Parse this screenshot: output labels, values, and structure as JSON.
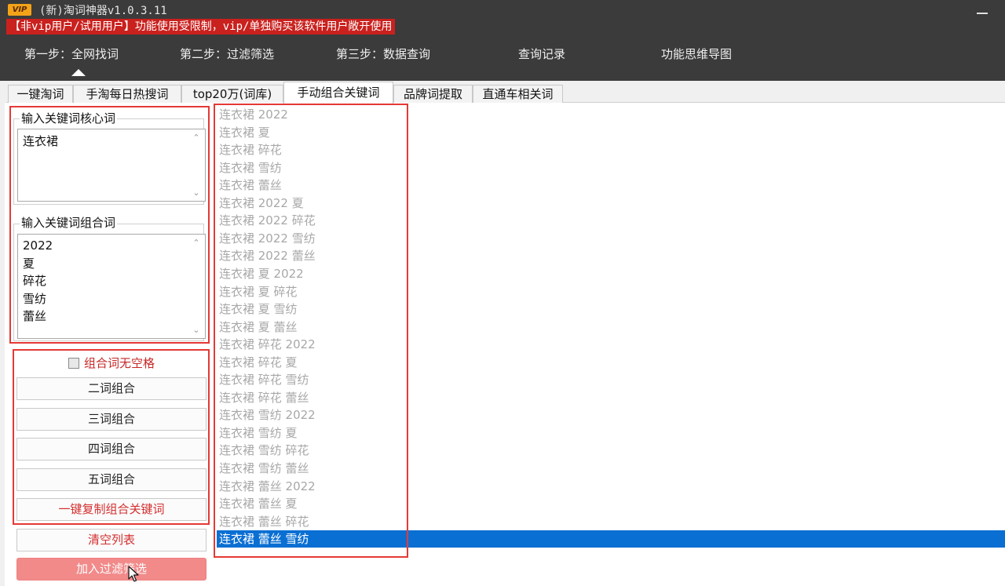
{
  "app": {
    "badge": "VIP",
    "title": "(新)淘词神器v1.0.3.11",
    "notice": "【非vip用户/试用用户】功能使用受限制，vip/单独购买该软件用户敞开使用"
  },
  "nav": [
    {
      "label": "第一步：全网找词"
    },
    {
      "label": "第二步：过滤筛选"
    },
    {
      "label": "第三步：数据查询"
    },
    {
      "label": "查询记录"
    },
    {
      "label": "功能思维导图"
    }
  ],
  "tabs": [
    {
      "label": "一键淘词"
    },
    {
      "label": "手淘每日热搜词"
    },
    {
      "label": "top20万(词库)"
    },
    {
      "label": "手动组合关键词"
    },
    {
      "label": "品牌词提取"
    },
    {
      "label": "直通车相关词"
    }
  ],
  "core_group": {
    "legend": "输入关键词核心词",
    "lines": [
      "连衣裙"
    ]
  },
  "combo_group": {
    "legend": "输入关键词组合词",
    "lines": [
      "2022",
      "夏",
      "碎花",
      "雪纺",
      "蕾丝"
    ]
  },
  "options": {
    "no_space_label": "组合词无空格"
  },
  "buttons": {
    "two_word": "二词组合",
    "three_word": "三词组合",
    "four_word": "四词组合",
    "five_word": "五词组合",
    "copy_all": "一键复制组合关键词",
    "clear_list": "清空列表",
    "add_filter": "加入过滤筛选"
  },
  "results": [
    "连衣裙 2022",
    "连衣裙 夏",
    "连衣裙 碎花",
    "连衣裙 雪纺",
    "连衣裙 蕾丝",
    "连衣裙 2022 夏",
    "连衣裙 2022 碎花",
    "连衣裙 2022 雪纺",
    "连衣裙 2022 蕾丝",
    "连衣裙 夏 2022",
    "连衣裙 夏 碎花",
    "连衣裙 夏 雪纺",
    "连衣裙 夏 蕾丝",
    "连衣裙 碎花 2022",
    "连衣裙 碎花 夏",
    "连衣裙 碎花 雪纺",
    "连衣裙 碎花 蕾丝",
    "连衣裙 雪纺 2022",
    "连衣裙 雪纺 夏",
    "连衣裙 雪纺 碎花",
    "连衣裙 雪纺 蕾丝",
    "连衣裙 蕾丝 2022",
    "连衣裙 蕾丝 夏",
    "连衣裙 蕾丝 碎花",
    "连衣裙 蕾丝 雪纺"
  ],
  "selected_result_index": 24,
  "colors": {
    "header_bg": "#3b3b3b",
    "notice_bg": "#c9211e",
    "selection": "#0a6fd3",
    "highlight_border": "#e53935",
    "add_filter_bg": "#f28a8a"
  }
}
